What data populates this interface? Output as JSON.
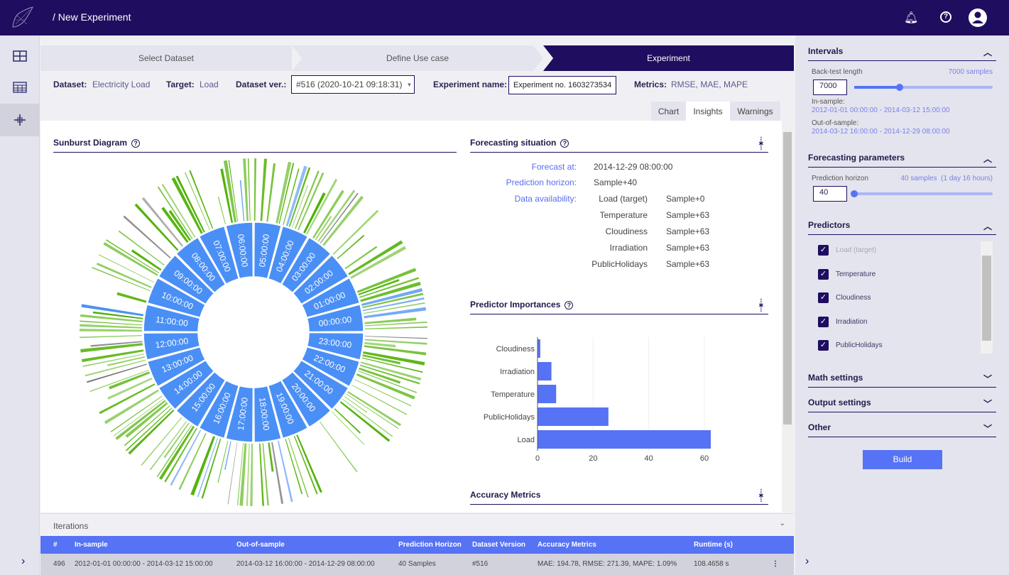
{
  "header": {
    "breadcrumb": "/ New Experiment",
    "icons": [
      "logo",
      "bell-icon",
      "help-icon",
      "account-icon"
    ]
  },
  "nav": {
    "items": [
      "dashboard-icon",
      "table-icon",
      "experiment-icon"
    ],
    "expand": "›"
  },
  "steps": [
    "Select Dataset",
    "Define Use case",
    "Experiment"
  ],
  "info": {
    "dataset_label": "Dataset:",
    "dataset": "Electricity Load",
    "target_label": "Target:",
    "target": "Load",
    "version_label": "Dataset ver.:",
    "version": "#516 (2020-10-21 09:18:31)",
    "exp_label": "Experiment name:",
    "exp_name": "Experiment no. 1603273534",
    "metrics_label": "Metrics:",
    "metrics": "RMSE, MAE, MAPE"
  },
  "tabs": [
    "Chart",
    "Insights",
    "Warnings"
  ],
  "sunburst": {
    "title": "Sunburst Diagram",
    "hours": [
      "00:00:00",
      "01:00:00",
      "02:00:00",
      "03:00:00",
      "04:00:00",
      "05:00:00",
      "06:00:00",
      "07:00:00",
      "08:00:00",
      "09:00:00",
      "10:00:00",
      "11:00:00",
      "12:00:00",
      "13:00:00",
      "14:00:00",
      "15:00:00",
      "16:00:00",
      "17:00:00",
      "18:00:00",
      "19:00:00",
      "20:00:00",
      "21:00:00",
      "22:00:00",
      "23:00:00"
    ],
    "colors": {
      "hour": "#4a8ff5",
      "feature": "#4caf00",
      "lag": "#4a8ff5",
      "other": "#6e6e6e"
    }
  },
  "forecast": {
    "title": "Forecasting situation",
    "forecast_at_label": "Forecast at:",
    "forecast_at": "2014-12-29 08:00:00",
    "horizon_label": "Prediction horizon:",
    "horizon": "Sample+40",
    "avail_label": "Data availability:",
    "availability": [
      {
        "name": "Load (target)",
        "value": "Sample+0"
      },
      {
        "name": "Temperature",
        "value": "Sample+63"
      },
      {
        "name": "Cloudiness",
        "value": "Sample+63"
      },
      {
        "name": "Irradiation",
        "value": "Sample+63"
      },
      {
        "name": "PublicHolidays",
        "value": "Sample+63"
      }
    ]
  },
  "importances": {
    "title": "Predictor Importances"
  },
  "chart_data": {
    "type": "bar",
    "orientation": "horizontal",
    "categories": [
      "Cloudiness",
      "Irradiation",
      "Temperature",
      "PublicHolidays",
      "Load"
    ],
    "values": [
      1,
      5,
      6.7,
      25.5,
      62.3
    ],
    "xticks": [
      "0",
      "20",
      "40",
      "60"
    ],
    "xlim": [
      0,
      64
    ],
    "grid": true,
    "color": "#5672f5"
  },
  "accuracy": {
    "title": "Accuracy Metrics"
  },
  "iterations": {
    "title": "Iterations",
    "columns": [
      "#",
      "In-sample",
      "Out-of-sample",
      "Prediction Horizon",
      "Dataset Version",
      "Accuracy Metrics",
      "Runtime (s)"
    ],
    "rows": [
      [
        "496",
        "2012-01-01 00:00:00 - 2014-03-12 15:00:00",
        "2014-03-12 16:00:00 - 2014-12-29 08:00:00",
        "40 Samples",
        "#516",
        "MAE: 194.78, RMSE: 271.39, MAPE: 1.09%",
        "108.4658 s"
      ]
    ]
  },
  "right": {
    "intervals": {
      "title": "Intervals",
      "backtest_label": "Back-test length",
      "backtest_info": "7000 samples",
      "backtest_value": "7000",
      "backtest_slider": 0.33,
      "in_label": "In-sample:",
      "in_value": "2012-01-01 00:00:00 - 2014-03-12 15:00:00",
      "out_label": "Out-of-sample:",
      "out_value": "2014-03-12 16:00:00 - 2014-12-29 08:00:00"
    },
    "forecasting": {
      "title": "Forecasting parameters",
      "horizon_label": "Prediction horizon",
      "horizon_info": "40 samples  (1 day 16 hours)",
      "horizon_value": "40",
      "horizon_slider": 0.0
    },
    "predictors": {
      "title": "Predictors",
      "items": [
        {
          "label": "Load (target)",
          "checked": true,
          "disabled": true
        },
        {
          "label": "Temperature",
          "checked": true
        },
        {
          "label": "Cloudiness",
          "checked": true
        },
        {
          "label": "Irradiation",
          "checked": true
        },
        {
          "label": "PublicHolidays",
          "checked": true
        }
      ]
    },
    "math": "Math settings",
    "output": "Output settings",
    "other": "Other",
    "build": "Build"
  },
  "colors": {
    "primary": "#1f0d5f",
    "accent": "#5672f5"
  }
}
